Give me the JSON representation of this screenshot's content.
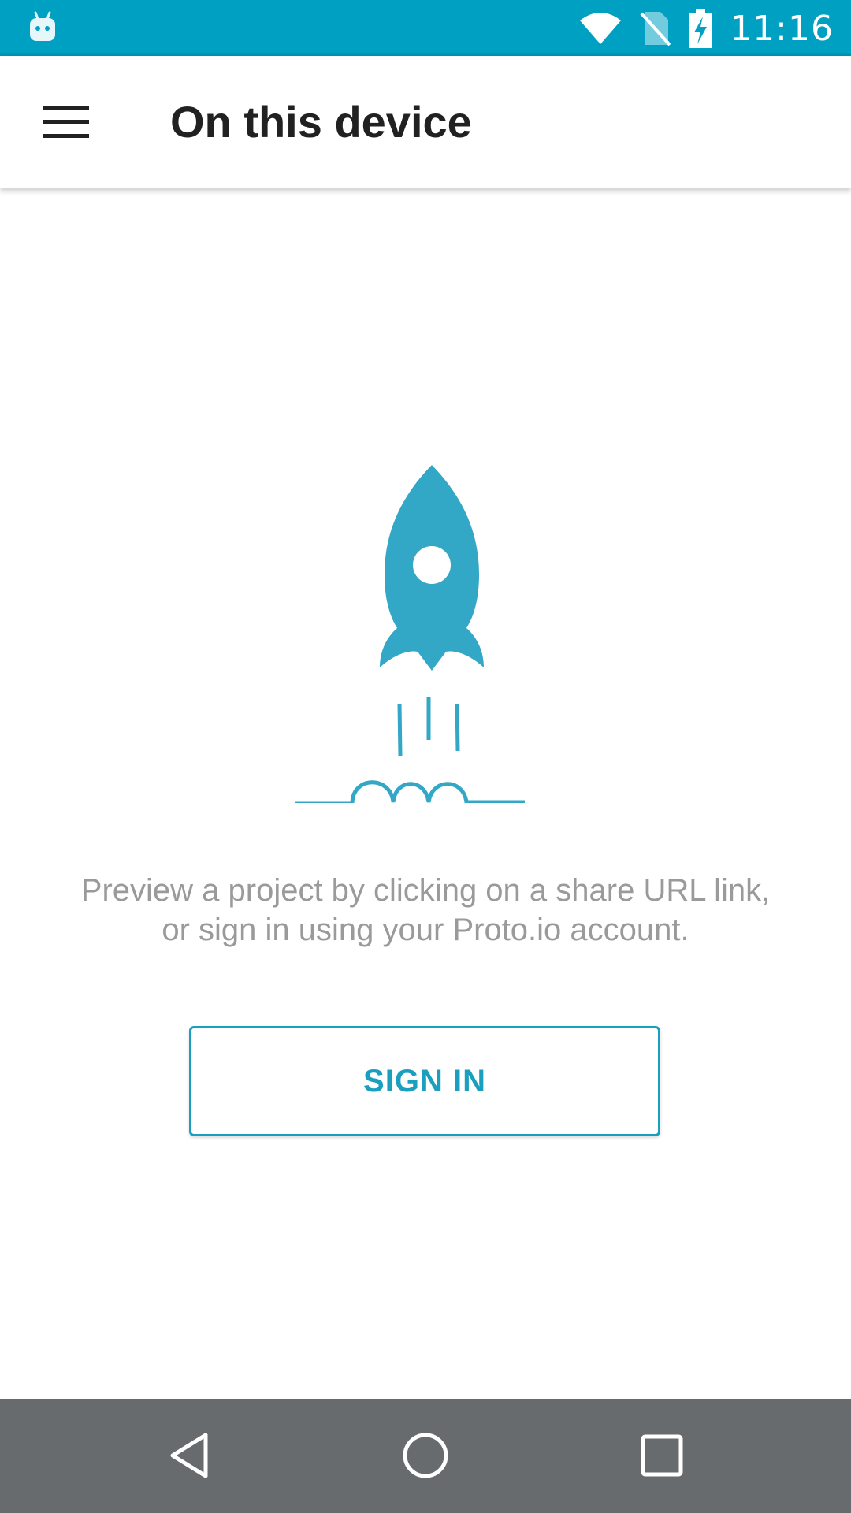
{
  "status_bar": {
    "time": "11:16",
    "icons": [
      "android-notification-icon",
      "wifi-icon",
      "no-sim-icon",
      "battery-charging-icon"
    ],
    "background_color": "#00a0c3"
  },
  "app_bar": {
    "menu_icon": "hamburger-menu-icon",
    "title": "On this device"
  },
  "main": {
    "illustration": "rocket-launch-illustration",
    "message": "Preview a project by clicking on a share URL link, or sign in using your Proto.io account.",
    "sign_in_label": "SIGN IN",
    "accent_color": "#1a9fbe"
  },
  "nav_bar": {
    "buttons": [
      "back-icon",
      "home-icon",
      "recents-icon"
    ],
    "background_color": "#676b6d"
  }
}
